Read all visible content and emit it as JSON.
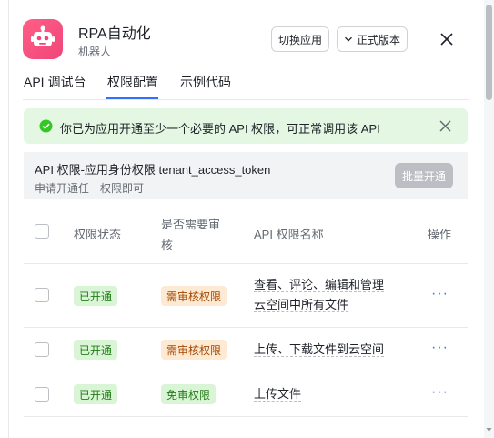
{
  "header": {
    "app_name": "RPA自动化",
    "app_subtitle": "机器人",
    "switch_app_label": "切换应用",
    "version_label": "正式版本"
  },
  "tabs": [
    {
      "label": "API 调试台"
    },
    {
      "label": "权限配置"
    },
    {
      "label": "示例代码"
    }
  ],
  "alert": {
    "text": "你已为应用开通至少一个必要的 API 权限，可正常调用该 API"
  },
  "group": {
    "title": "API 权限-应用身份权限 tenant_access_token",
    "subtitle": "申请开通任一权限即可",
    "bulk_label": "批量开通"
  },
  "table": {
    "headers": {
      "status": "权限状态",
      "review_line1": "是否需要审",
      "review_line2": "核",
      "name": "API 权限名称",
      "action": "操作"
    },
    "rows": [
      {
        "status": "已开通",
        "review": "需审核权限",
        "name_line1": "查看、评论、编辑和管理",
        "name_line2": "云空间中所有文件",
        "action": "···"
      },
      {
        "status": "已开通",
        "review": "需审核权限",
        "name_line1": "上传、下载文件到云空间",
        "name_line2": "",
        "action": "···"
      },
      {
        "status": "已开通",
        "review": "免审权限",
        "name_line1": "上传文件",
        "name_line2": "",
        "action": "···"
      }
    ]
  },
  "colors": {
    "accent": "#3370ff",
    "app_icon": "#f0457a",
    "success_bg": "#e4f7e3",
    "success_icon": "#34c724"
  }
}
